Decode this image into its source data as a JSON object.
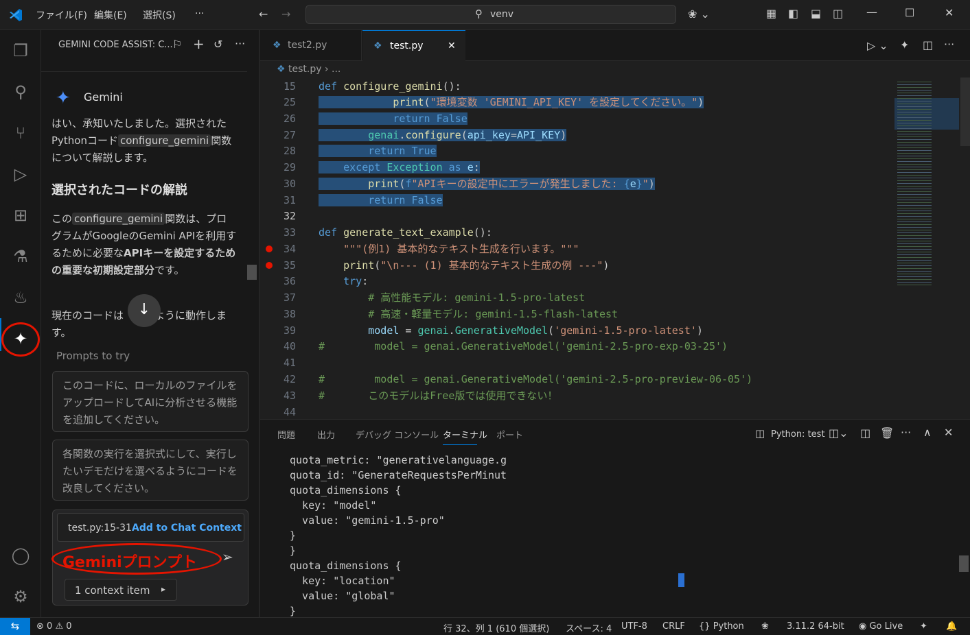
{
  "titlebar": {
    "menus": [
      "ファイル(F)",
      "編集(E)",
      "選択(S)",
      "···"
    ],
    "search_text": "venv"
  },
  "activity": {
    "items": [
      "explorer-icon",
      "search-icon",
      "source-control-icon",
      "run-debug-icon",
      "extensions-icon",
      "testing-icon",
      "genie-icon",
      "gemini-icon",
      "account-icon",
      "settings-gear-icon"
    ]
  },
  "side": {
    "title": "GEMINI CODE ASSIST: C...",
    "agent_name": "Gemini",
    "intro_1": "はい、承知いたしました。選択されたPythonコード",
    "intro_chip": "configure_gemini",
    "intro_2": "関数について解説します。",
    "heading": "選択されたコードの解説",
    "para_1": "この",
    "para_chip": "configure_gemini",
    "para_2": "関数は、プログラムがGoogleのGemini APIを利用するために必要な",
    "para_bold": "APIキーを設定するための重要な初期設定部分",
    "para_3": "です。",
    "para_4": "現在のコードは",
    "para_5": "のように動作します。",
    "prompts_label": "Prompts to try",
    "prompt_1": "このコードに、ローカルのファイルをアップロードしてAIに分析させる機能を追加してください。",
    "prompt_2": "各関数の実行を選択式にして、実行したいデモだけを選べるようにコードを改良してください。",
    "context_file": "test.py:15-31",
    "add_context": "Add to Chat Context",
    "input_placeholder": "Geminiプロンプト",
    "context_count": "1 context item"
  },
  "tabs": [
    {
      "label": "test2.py",
      "active": false
    },
    {
      "label": "test.py",
      "active": true
    }
  ],
  "breadcrumb": {
    "file": "test.py",
    "more": "..."
  },
  "code_lines": [
    {
      "ln": "15",
      "html": "<span class='kw'>def</span> <span class='fn'>configure_gemini</span>():"
    },
    {
      "ln": "25",
      "html": "<span class='sel'>            <span class='fn'>print</span>(<span class='str'>\"環境変数 'GEMINI_API_KEY' を設定してください。\"</span>)</span>"
    },
    {
      "ln": "26",
      "html": "<span class='sel'>            <span class='kw'>return</span> <span class='kw'>False</span></span>"
    },
    {
      "ln": "27",
      "html": "<span class='sel'>        <span class='cls'>genai</span>.<span class='fn'>configure</span>(<span class='var'>api_key</span>=<span class='var'>API_KEY</span>)</span>"
    },
    {
      "ln": "28",
      "html": "<span class='sel'>        <span class='kw'>return</span> <span class='kw'>True</span></span>"
    },
    {
      "ln": "29",
      "html": "<span class='sel'>    <span class='kw'>except</span> <span class='cls'>Exception</span> <span class='kw'>as</span> <span class='var'>e</span>:</span>"
    },
    {
      "ln": "30",
      "html": "<span class='sel'>        <span class='fn'>print</span>(<span class='kw'>f</span><span class='str'>\"APIキーの設定中にエラーが発生しました: </span><span class='kw'>{</span><span class='var'>e</span><span class='kw'>}</span><span class='str'>\"</span>)</span>"
    },
    {
      "ln": "31",
      "html": "<span class='sel'>        <span class='kw'>return</span> <span class='kw'>False</span></span>"
    },
    {
      "ln": "32",
      "html": ""
    },
    {
      "ln": "33",
      "html": "<span class='kw'>def</span> <span class='fn'>generate_text_example</span>():"
    },
    {
      "ln": "34",
      "html": "    <span class='str'>\"\"\"(例1) 基本的なテキスト生成を行います。\"\"\"</span>",
      "bp": true
    },
    {
      "ln": "35",
      "html": "    <span class='fn'>print</span>(<span class='str'>\"\\n--- (1) 基本的なテキスト生成の例 ---\"</span>)",
      "bp": true
    },
    {
      "ln": "36",
      "html": "    <span class='kw'>try</span>:"
    },
    {
      "ln": "37",
      "html": "        <span class='cmt'># 高性能モデル: gemini-1.5-pro-latest</span>"
    },
    {
      "ln": "38",
      "html": "        <span class='cmt'># 高速・軽量モデル: gemini-1.5-flash-latest</span>"
    },
    {
      "ln": "39",
      "html": "        <span class='var'>model</span> = <span class='cls'>genai</span>.<span class='cls'>GenerativeModel</span>(<span class='str'>'gemini-1.5-pro-latest'</span>)"
    },
    {
      "ln": "40",
      "html": "<span class='cmt'>#        model = genai.GenerativeModel('gemini-2.5-pro-exp-03-25')</span>"
    },
    {
      "ln": "41",
      "html": ""
    },
    {
      "ln": "42",
      "html": "<span class='cmt'>#        model = genai.GenerativeModel('gemini-2.5-pro-preview-06-05')</span>"
    },
    {
      "ln": "43",
      "html": "<span class='cmt'>#       このモデルはFree版では使用できない！</span>"
    },
    {
      "ln": "44",
      "html": ""
    }
  ],
  "panel": {
    "tabs": [
      "問題",
      "出力",
      "デバッグ コンソール",
      "ターミナル",
      "ポート"
    ],
    "active_tab": "ターミナル",
    "terminal_name": "Python: test",
    "terminal_lines": [
      "quota_metric: \"generativelanguage.g",
      "quota_id: \"GenerateRequestsPerMinut",
      "quota_dimensions {",
      "  key: \"model\"",
      "  value: \"gemini-1.5-pro\"",
      "}",
      "}",
      "quota_dimensions {",
      "  key: \"location\"",
      "  value: \"global\"",
      "}"
    ]
  },
  "status": {
    "errors": "0",
    "warnings": "0",
    "position": "行 32、列 1 (610 個選択)",
    "spaces": "スペース: 4",
    "encoding": "UTF-8",
    "eol": "CRLF",
    "language": "Python",
    "interpreter": "3.11.2 64-bit",
    "golive": "Go Live"
  },
  "colors": {
    "accent": "#0078d4",
    "annotation_red": "#e51400",
    "selection": "#264f78"
  }
}
